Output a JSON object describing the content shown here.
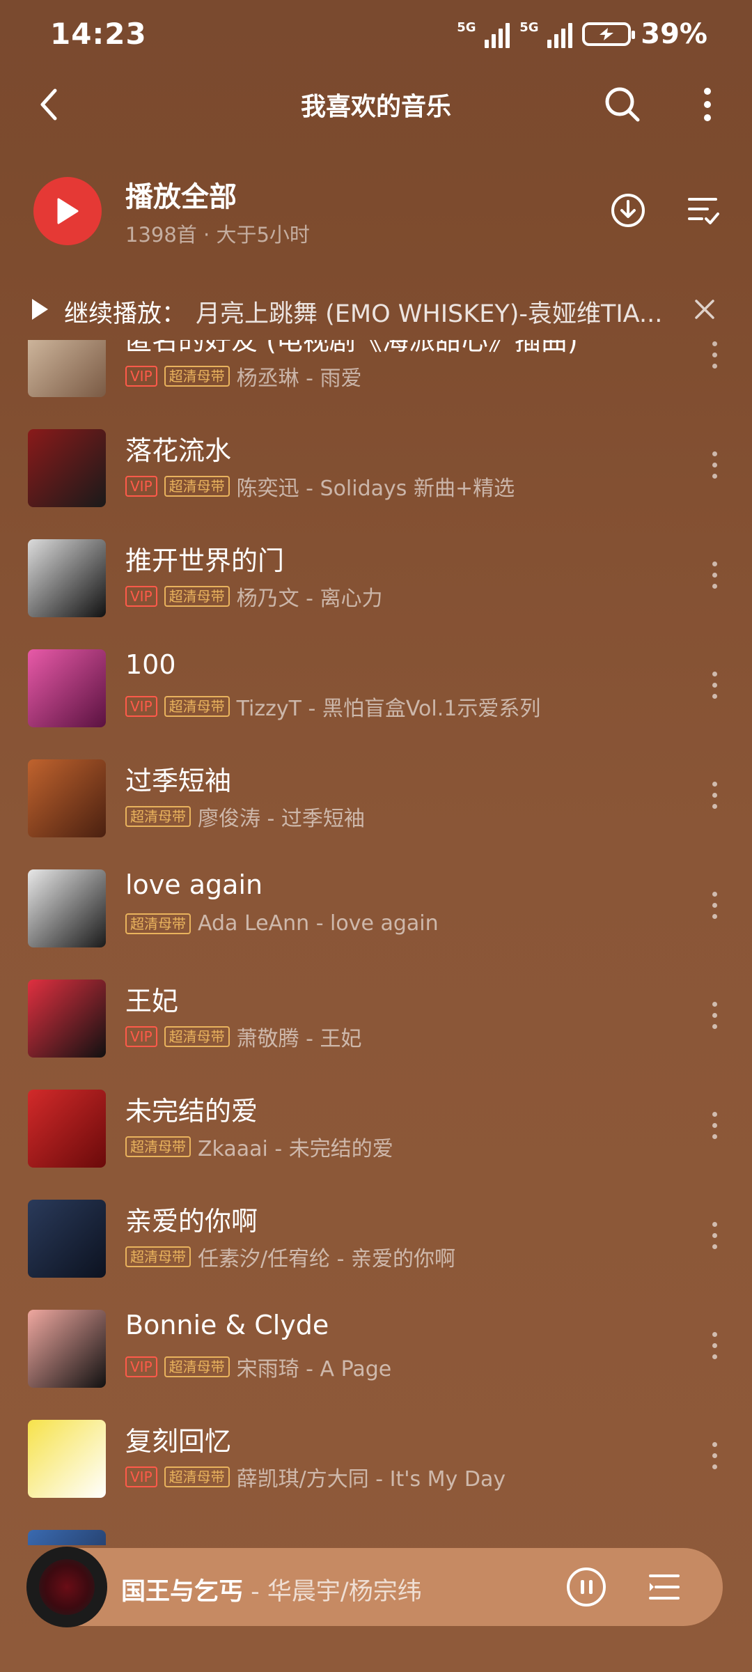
{
  "status": {
    "time": "14:23",
    "signal1": "5G",
    "signal2": "5G",
    "battery": "39%"
  },
  "header": {
    "title": "我喜欢的音乐"
  },
  "playall": {
    "label": "播放全部",
    "sub": "1398首 · 大于5小时"
  },
  "continue": {
    "label": "继续播放：",
    "song": "月亮上跳舞 (EMO WHISKEY)-袁娅维TIA..."
  },
  "songs": [
    {
      "name": "匿名的好友 (电视剧《海派甜心》插曲)",
      "vip": "VIP",
      "uhq": "超清母带",
      "meta": "杨丞琳 - 雨爱",
      "colors": [
        "#d9c2a8",
        "#7a5a44"
      ]
    },
    {
      "name": "落花流水",
      "vip": "VIP",
      "uhq": "超清母带",
      "meta": "陈奕迅 - Solidays 新曲+精选",
      "colors": [
        "#8a1a1a",
        "#1a1a1a"
      ]
    },
    {
      "name": "推开世界的门",
      "vip": "VIP",
      "uhq": "超清母带",
      "meta": "杨乃文 - 离心力",
      "colors": [
        "#dcdcdc",
        "#111111"
      ]
    },
    {
      "name": "100",
      "vip": "VIP",
      "uhq": "超清母带",
      "meta": "TizzyT - 黑怕盲盒Vol.1示爱系列",
      "colors": [
        "#e85aa8",
        "#5a1240"
      ]
    },
    {
      "name": "过季短袖",
      "vip": "",
      "uhq": "超清母带",
      "meta": "廖俊涛 - 过季短袖",
      "colors": [
        "#c0632e",
        "#4a2010"
      ]
    },
    {
      "name": "love again",
      "vip": "",
      "uhq": "超清母带",
      "meta": "Ada LeAnn - love again",
      "colors": [
        "#e8e8e8",
        "#1a1a1a"
      ]
    },
    {
      "name": "王妃",
      "vip": "VIP",
      "uhq": "超清母带",
      "meta": "萧敬腾 - 王妃",
      "colors": [
        "#e03040",
        "#111111"
      ]
    },
    {
      "name": "未完结的爱",
      "vip": "",
      "uhq": "超清母带",
      "meta": "Zkaaai - 未完结的爱",
      "colors": [
        "#d22a2a",
        "#6a0a0a"
      ]
    },
    {
      "name": "亲爱的你啊",
      "vip": "",
      "uhq": "超清母带",
      "meta": "任素汐/任宥纶 - 亲爱的你啊",
      "colors": [
        "#2a3a5a",
        "#0c1220"
      ]
    },
    {
      "name": "Bonnie & Clyde",
      "vip": "VIP",
      "uhq": "超清母带",
      "meta": "宋雨琦 - A Page",
      "colors": [
        "#f0a8a0",
        "#111111"
      ]
    },
    {
      "name": "复刻回忆",
      "vip": "VIP",
      "uhq": "超清母带",
      "meta": "薛凯琪/方大同 - It's My Day",
      "colors": [
        "#f6e24a",
        "#ffffff"
      ]
    },
    {
      "name": "",
      "vip": "",
      "uhq": "",
      "meta": "",
      "colors": [
        "#3a6ab0",
        "#1a2a4a"
      ]
    }
  ],
  "player": {
    "song": "国王与乞丐",
    "artist": "华晨宇/杨宗纬"
  }
}
